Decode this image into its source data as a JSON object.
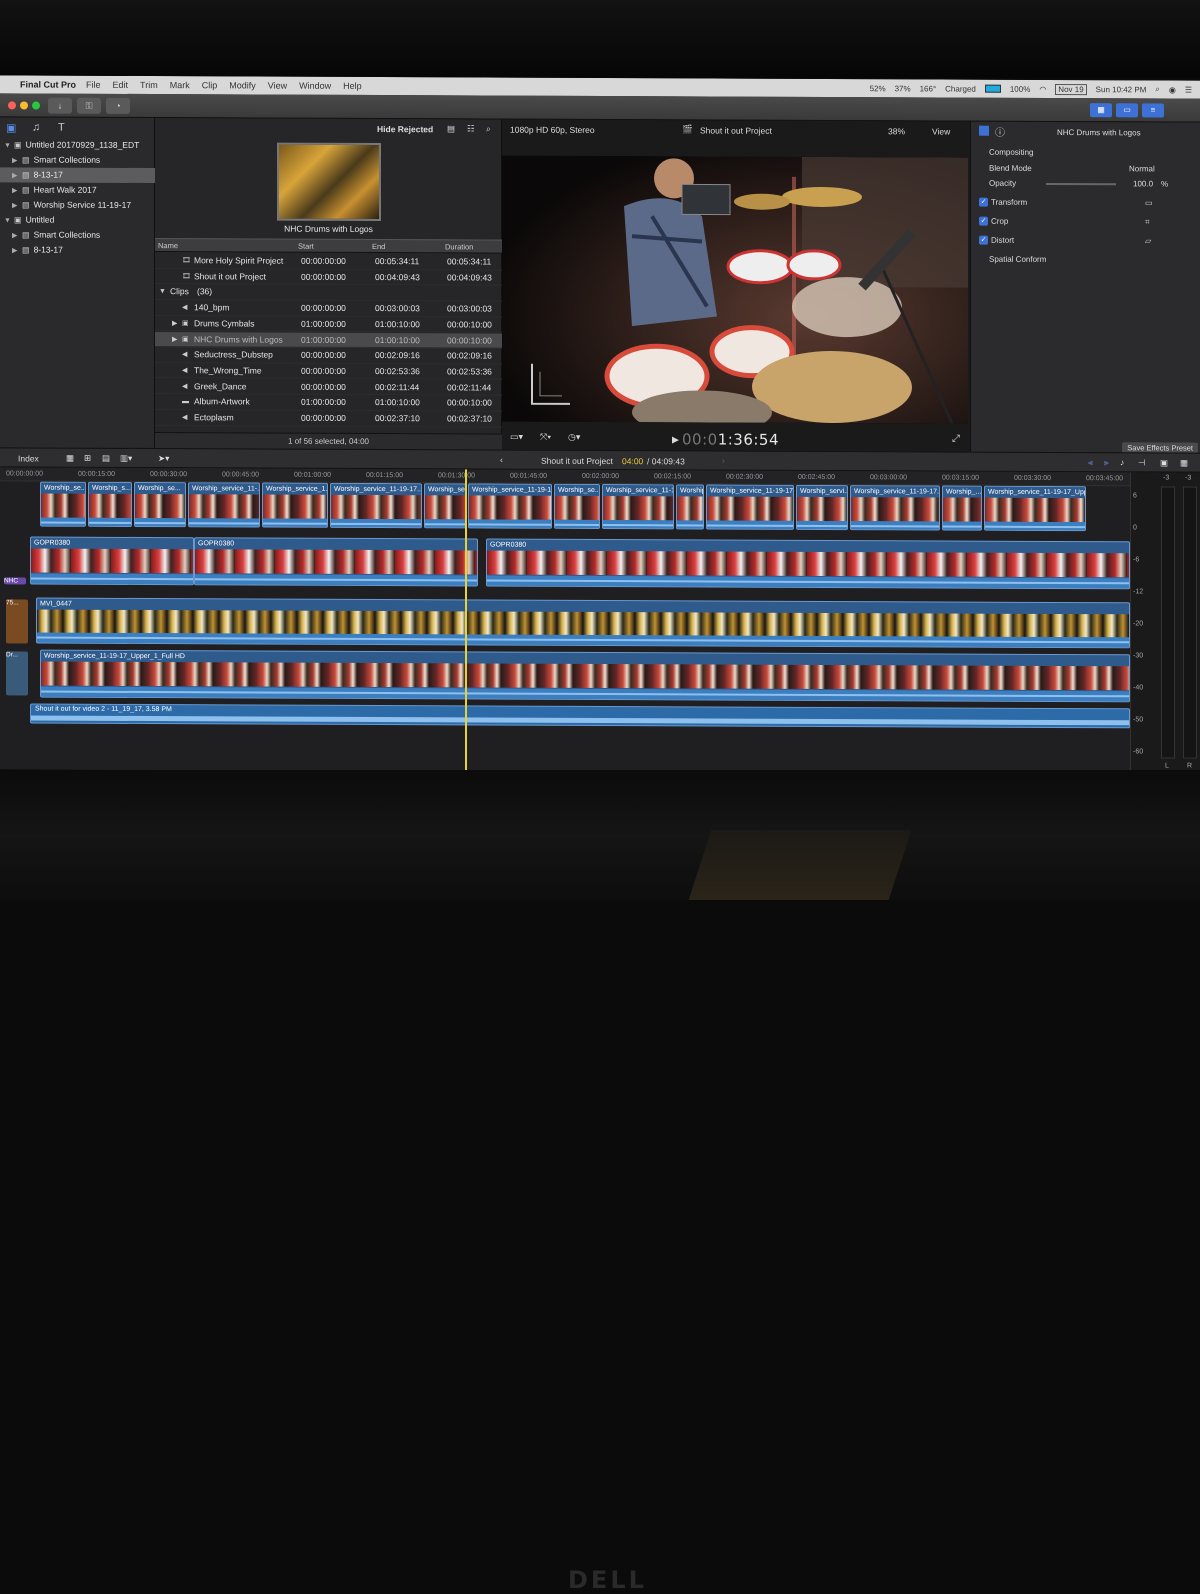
{
  "monitor": {
    "brand": "DELL"
  },
  "menubar": {
    "app_name": "Final Cut Pro",
    "items": [
      "File",
      "Edit",
      "Trim",
      "Mark",
      "Clip",
      "Modify",
      "View",
      "Window",
      "Help"
    ],
    "status": {
      "cpu1": "52%",
      "cpu2": "37%",
      "temp": "166°",
      "battery_state": "Charged",
      "battery_pct": "100%",
      "date": "Nov 19",
      "clock": "Sun 10:42 PM"
    }
  },
  "library": {
    "rows": [
      {
        "label": "Untitled 20170929_1138_EDT",
        "level": 0,
        "expanded": true,
        "selected": false
      },
      {
        "label": "Smart Collections",
        "level": 1,
        "expanded": false,
        "selected": false
      },
      {
        "label": "8-13-17",
        "level": 1,
        "expanded": false,
        "selected": true
      },
      {
        "label": "Heart Walk 2017",
        "level": 1,
        "expanded": false,
        "selected": false
      },
      {
        "label": "Worship Service 11-19-17",
        "level": 1,
        "expanded": false,
        "selected": false
      },
      {
        "label": "Untitled",
        "level": 0,
        "expanded": true,
        "selected": false
      },
      {
        "label": "Smart Collections",
        "level": 1,
        "expanded": false,
        "selected": false
      },
      {
        "label": "8-13-17",
        "level": 1,
        "expanded": false,
        "selected": false
      }
    ]
  },
  "browser": {
    "filter": "Hide Rejected",
    "preview_title": "NHC Drums with Logos",
    "columns": [
      "Name",
      "Start",
      "End",
      "Duration"
    ],
    "rows": [
      {
        "name": "More Holy Spirit Project",
        "start": "00:00:00:00",
        "end": "00:05:34:11",
        "duration": "00:05:34:11",
        "kind": "project"
      },
      {
        "name": "Shout it out Project",
        "start": "00:00:00:00",
        "end": "00:04:09:43",
        "duration": "00:04:09:43",
        "kind": "project"
      },
      {
        "name": "Clips",
        "count": "(36)",
        "kind": "group"
      },
      {
        "name": "140_bpm",
        "start": "00:00:00:00",
        "end": "00:03:00:03",
        "duration": "00:03:00:03",
        "kind": "audio"
      },
      {
        "name": "Drums Cymbals",
        "start": "01:00:00:00",
        "end": "01:00:10:00",
        "duration": "00:00:10:00",
        "kind": "compound"
      },
      {
        "name": "NHC Drums with Logos",
        "start": "01:00:00:00",
        "end": "01:00:10:00",
        "duration": "00:00:10:00",
        "kind": "compound",
        "selected": true
      },
      {
        "name": "Seductress_Dubstep",
        "start": "00:00:00:00",
        "end": "00:02:09:16",
        "duration": "00:02:09:16",
        "kind": "audio"
      },
      {
        "name": "The_Wrong_Time",
        "start": "00:00:00:00",
        "end": "00:02:53:36",
        "duration": "00:02:53:36",
        "kind": "audio"
      },
      {
        "name": "Greek_Dance",
        "start": "00:00:00:00",
        "end": "00:02:11:44",
        "duration": "00:02:11:44",
        "kind": "audio"
      },
      {
        "name": "Album-Artwork",
        "start": "01:00:00:00",
        "end": "01:00:10:00",
        "duration": "00:00:10:00",
        "kind": "video"
      },
      {
        "name": "Ectoplasm",
        "start": "00:00:00:00",
        "end": "00:02:37:10",
        "duration": "00:02:37:10",
        "kind": "audio"
      }
    ],
    "footer": "1 of 56 selected, 04:00"
  },
  "viewer": {
    "format": "1080p HD 60p, Stereo",
    "title": "Shout it out Project",
    "zoom": "38%",
    "view_menu": "View",
    "timecode_dim": "00:0",
    "timecode_bright": "1:36:54"
  },
  "inspector": {
    "title": "NHC Drums with Logos",
    "compositing": "Compositing",
    "blend_label": "Blend Mode",
    "blend_value": "Normal",
    "opacity_label": "Opacity",
    "opacity_value": "100.0",
    "opacity_unit": "%",
    "effects": [
      "Transform",
      "Crop",
      "Distort"
    ],
    "spatial": "Spatial Conform",
    "save_preset": "Save Effects Preset"
  },
  "timeline": {
    "index_label": "Index",
    "project": "Shout it out Project",
    "position": "04:00",
    "duration": "/ 04:09:43",
    "ruler": [
      "00:00:00:00",
      "00:00:15:00",
      "00:00:30:00",
      "00:00:45:00",
      "00:01:00:00",
      "00:01:15:00",
      "00:01:30:00",
      "00:01:45:00",
      "00:02:00:00",
      "00:02:15:00",
      "00:02:30:00",
      "00:02:45:00",
      "00:03:00:00",
      "00:03:15:00",
      "00:03:30:00",
      "00:03:45:00"
    ],
    "row1_labels": [
      "Worship_se...",
      "Worship_s...",
      "Worship_se...",
      "Worship_service_11-...",
      "Worship_service_1...",
      "Worship_service_11-19-17...",
      "Worship_se...",
      "Worship_service_11-19-17...",
      "Worship_se...",
      "Worship_service_11-1...",
      "Worship...",
      "Worship_service_11-19-17...",
      "Worship_servi...",
      "Worship_service_11-19-17...",
      "Worship_...",
      "Worship_service_11-19-17_Upper..."
    ],
    "gopro_label": "GOPR0380",
    "nhc_tag": "NHC",
    "tag_75": "75...",
    "tag_dr": "Dr...",
    "mvi_label": "MVI_0447",
    "upper_label": "Worship_service_11-19-17_Upper_1_Full HD",
    "audio_label": "Shout it out for video 2 - 11_19_17, 3.58 PM",
    "meter_scale": [
      "6",
      "0",
      "-6",
      "-12",
      "-20",
      "-30",
      "-40",
      "-50",
      "-60"
    ],
    "meter_peaks": [
      "-3",
      "-3"
    ],
    "meter_channels": [
      "L",
      "R"
    ]
  },
  "colors": {
    "accent": "#3e71d6",
    "playhead": "#e8d23a",
    "clip_blue": "#2f5a8c"
  }
}
